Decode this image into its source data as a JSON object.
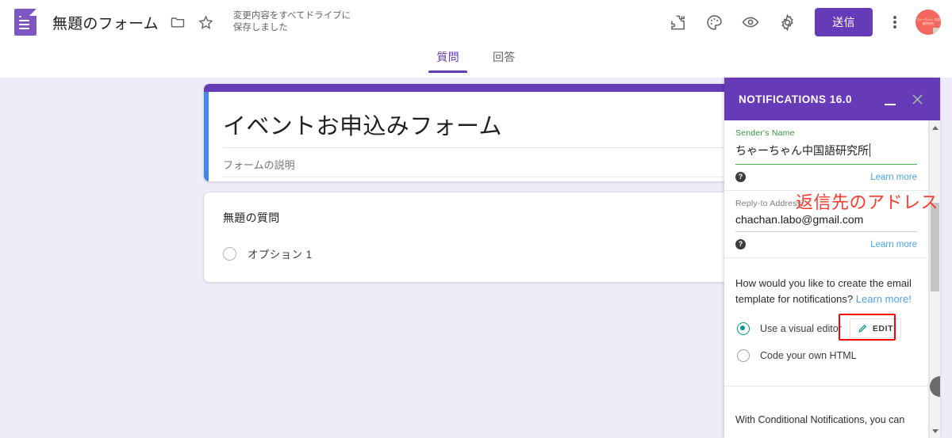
{
  "header": {
    "logo_icon": "google-forms-icon",
    "doc_title": "無題のフォーム",
    "folder_icon": "folder-icon",
    "star_icon": "star-icon",
    "save_status": "変更内容をすべてドライブに\n保存しました",
    "addons_icon": "puzzle-piece-icon",
    "theme_icon": "palette-icon",
    "preview_icon": "eye-icon",
    "settings_icon": "gear-icon",
    "send_label": "送信",
    "more_icon": "kebab-menu-icon",
    "avatar_text": "ちゃーちゃん\n中国語研究所"
  },
  "tabs": [
    {
      "label": "質問",
      "active": true
    },
    {
      "label": "回答",
      "active": false
    }
  ],
  "form": {
    "title": "イベントお申込みフォーム",
    "description_placeholder": "フォームの説明",
    "accent_top_color": "#673ab7",
    "selected_edge_color": "#4285f4",
    "question": {
      "title": "無題の質問",
      "options": [
        "オプション 1"
      ]
    }
  },
  "panel": {
    "title": "NOTIFICATIONS 16.0",
    "minimize_icon": "minimize-icon",
    "close_icon": "close-icon",
    "header_color": "#673ab7",
    "fields": [
      {
        "label": "Sender's Name",
        "value": "ちゃーちゃん中国語研究所",
        "help_icon": "help-circle-icon",
        "learn_more": "Learn more",
        "focused": true
      },
      {
        "label": "Reply-to Address",
        "value": "chachan.labo@gmail.com",
        "help_icon": "help-circle-icon",
        "learn_more": "Learn more",
        "focused": false
      }
    ],
    "template_question": "How would you like to create the email template for notifications? ",
    "template_question_link": "Learn more!",
    "radio_options": [
      {
        "label": "Use a visual editor",
        "checked": true
      },
      {
        "label": "Code your own HTML",
        "checked": false
      }
    ],
    "edit_button": {
      "label": "EDIT",
      "icon": "pencil-icon"
    },
    "footer_text": "With Conditional Notifications, you can",
    "scrollbar": {
      "up_icon": "scroll-up-arrow-icon",
      "down_icon": "scroll-down-arrow-icon"
    }
  },
  "annotations": {
    "reply_to": "返信先のアドレス",
    "color": "#fc3a2b",
    "highlight_box_color": "#ff0000"
  }
}
